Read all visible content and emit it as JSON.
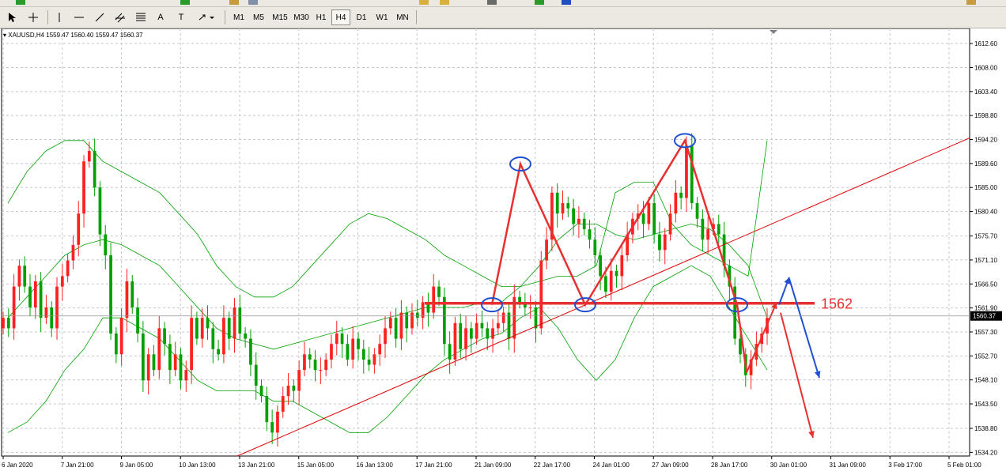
{
  "toolbar": {
    "timeframes": [
      "M1",
      "M5",
      "M15",
      "M30",
      "H1",
      "H4",
      "D1",
      "W1",
      "MN"
    ],
    "active_timeframe": "H4",
    "text_tool_label": "A",
    "text_label_tool": "T"
  },
  "symbol_info": {
    "symbol": "XAUUSD,H4",
    "ohlc": "1559.47 1560.40 1559.47 1560.37"
  },
  "colors": {
    "bull": "#ff2020",
    "bear": "#00a000",
    "grid": "#c0c8d0",
    "bands": "#00a000",
    "annotation_red": "#e83030",
    "annotation_blue": "#2050d0",
    "trendline": "#e00000"
  },
  "chart_data": {
    "type": "candlestick",
    "title": "",
    "xlabel": "",
    "ylabel": "",
    "ylim": [
      1533.5,
      1615.5
    ],
    "grid": true,
    "current_price": "1560.37",
    "y_ticks": [
      "1612.60",
      "1608.00",
      "1603.40",
      "1598.80",
      "1594.20",
      "1589.60",
      "1585.00",
      "1580.40",
      "1575.70",
      "1571.10",
      "1566.50",
      "1561.90",
      "1557.30",
      "1552.70",
      "1548.10",
      "1543.50",
      "1538.80",
      "1534.20"
    ],
    "x_ticks": [
      "6 Jan 2020",
      "7 Jan 21:00",
      "9 Jan 05:00",
      "10 Jan 13:00",
      "13 Jan 21:00",
      "15 Jan 05:00",
      "16 Jan 13:00",
      "17 Jan 21:00",
      "21 Jan 09:00",
      "22 Jan 17:00",
      "24 Jan 01:00",
      "27 Jan 09:00",
      "28 Jan 17:00",
      "30 Jan 01:00",
      "31 Jan 09:00",
      "3 Feb 17:00",
      "5 Feb 01:00"
    ],
    "series_close": [
      1560,
      1558,
      1566,
      1570,
      1566,
      1562,
      1567,
      1560,
      1562,
      1558,
      1566,
      1568,
      1571,
      1574,
      1580,
      1590,
      1592,
      1585,
      1576,
      1572,
      1557,
      1553,
      1560,
      1567,
      1562,
      1557,
      1548,
      1553,
      1550,
      1558,
      1555,
      1550,
      1553,
      1548,
      1550,
      1560,
      1556,
      1560,
      1558,
      1554,
      1553,
      1560,
      1556,
      1562,
      1557,
      1556,
      1551,
      1547,
      1545,
      1540,
      1538,
      1542,
      1545,
      1547,
      1546,
      1550,
      1553,
      1552,
      1550,
      1550,
      1552,
      1555,
      1557,
      1555,
      1552,
      1556,
      1554,
      1552,
      1551,
      1553,
      1555,
      1558,
      1560,
      1556,
      1561,
      1558,
      1561,
      1560,
      1563,
      1561,
      1566,
      1564,
      1555,
      1552,
      1559,
      1554,
      1558,
      1556,
      1559,
      1558,
      1556,
      1558,
      1559,
      1561,
      1556,
      1564,
      1563,
      1562,
      1562,
      1558,
      1571,
      1575,
      1584,
      1580,
      1582,
      1581,
      1578,
      1579,
      1577,
      1575,
      1572,
      1568,
      1565,
      1569,
      1568,
      1572,
      1576,
      1579,
      1580,
      1578,
      1582,
      1576,
      1573,
      1576,
      1580,
      1584,
      1583,
      1593,
      1582,
      1579,
      1575,
      1577,
      1578,
      1576,
      1570,
      1566,
      1556,
      1553,
      1549,
      1552,
      1555,
      1557,
      1560
    ],
    "bollinger": {
      "upper": [
        1582,
        1588,
        1592,
        1594,
        1594,
        1590,
        1588,
        1586,
        1584,
        1580,
        1576,
        1570,
        1566,
        1564,
        1564,
        1566,
        1570,
        1574,
        1578,
        1580,
        1579,
        1577,
        1575,
        1572,
        1570,
        1568,
        1566,
        1566,
        1567,
        1568,
        1568,
        1570,
        1584,
        1586,
        1586,
        1578,
        1574,
        1572,
        1570,
        1568,
        1594
      ],
      "middle": [
        1560,
        1564,
        1568,
        1572,
        1574,
        1575,
        1574,
        1572,
        1570,
        1566,
        1562,
        1558,
        1556,
        1555,
        1554,
        1555,
        1556,
        1557,
        1558,
        1559,
        1560,
        1561,
        1562,
        1562,
        1562,
        1563,
        1563,
        1566,
        1570,
        1575,
        1578,
        1578,
        1576,
        1575,
        1576,
        1577,
        1578,
        1577,
        1574,
        1570,
        1560
      ],
      "lower": [
        1538,
        1540,
        1544,
        1550,
        1554,
        1560,
        1560,
        1558,
        1556,
        1552,
        1548,
        1546,
        1546,
        1546,
        1544,
        1544,
        1542,
        1540,
        1538,
        1538,
        1541,
        1545,
        1549,
        1552,
        1554,
        1556,
        1557,
        1560,
        1562,
        1558,
        1552,
        1548,
        1552,
        1560,
        1566,
        1568,
        1570,
        1568,
        1562,
        1556,
        1550
      ]
    },
    "annotations": {
      "support_level_label": "1562",
      "support_level": 1562.8,
      "pattern_points": [
        1562.5,
        1589.5,
        1562.5,
        1594,
        1562.5
      ]
    }
  }
}
